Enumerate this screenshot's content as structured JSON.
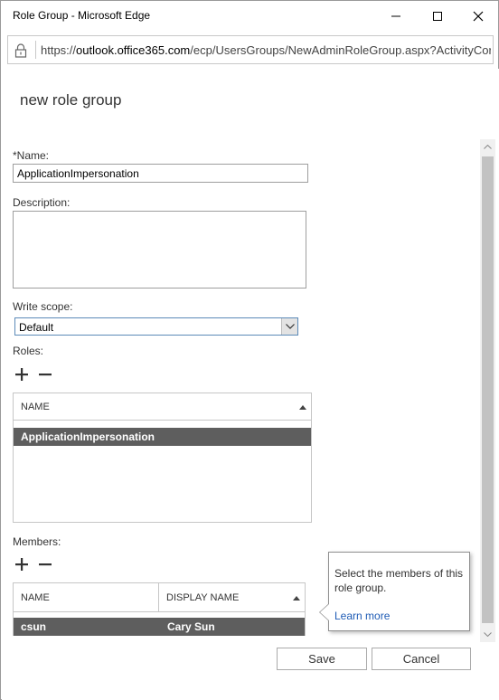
{
  "window": {
    "title": "Role Group - Microsoft Edge"
  },
  "address_bar": {
    "url_prefix": "https://",
    "url_host": "outlook.office365.com",
    "url_path": "/ecp/UsersGroups/NewAdminRoleGroup.aspx?ActivityCorr"
  },
  "page": {
    "title": "new role group"
  },
  "form": {
    "name_label": "*Name:",
    "name_value": "ApplicationImpersonation",
    "description_label": "Description:",
    "description_value": "",
    "write_scope_label": "Write scope:",
    "write_scope_value": "Default",
    "roles_label": "Roles:",
    "members_label": "Members:"
  },
  "roles_grid": {
    "columns": [
      "NAME"
    ],
    "rows": [
      {
        "name": "ApplicationImpersonation",
        "selected": true
      }
    ]
  },
  "members_grid": {
    "columns": [
      "NAME",
      "DISPLAY NAME"
    ],
    "rows": [
      {
        "name": "csun",
        "display_name": "Cary Sun",
        "selected": true
      }
    ]
  },
  "tooltip": {
    "text": "Select the members of this role group.",
    "link": "Learn more"
  },
  "buttons": {
    "save": "Save",
    "cancel": "Cancel"
  },
  "icons": {
    "add": "plus-icon",
    "remove": "minus-icon"
  },
  "colors": {
    "selected_row": "#5e5e5e",
    "link": "#1e5bb5"
  }
}
